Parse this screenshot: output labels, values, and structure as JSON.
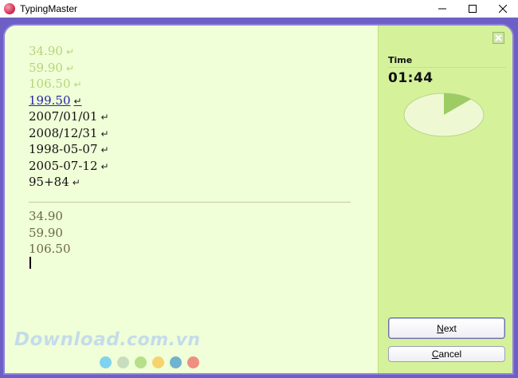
{
  "window": {
    "title": "TypingMaster"
  },
  "exercise": {
    "lines": [
      {
        "text": "34.90",
        "state": "done"
      },
      {
        "text": "59.90",
        "state": "done"
      },
      {
        "text": "106.50",
        "state": "done"
      },
      {
        "text": "199.50",
        "state": "current"
      },
      {
        "text": "2007/01/01",
        "state": "pending"
      },
      {
        "text": "2008/12/31",
        "state": "pending"
      },
      {
        "text": "1998-05-07",
        "state": "pending"
      },
      {
        "text": "2005-07-12",
        "state": "pending"
      },
      {
        "text": "95+84",
        "state": "pending"
      }
    ],
    "return_symbol": "↵",
    "typed": [
      "34.90",
      "59.90",
      "106.50"
    ]
  },
  "timer": {
    "label": "Time",
    "value": "01:44",
    "elapsed_fraction": 0.12
  },
  "buttons": {
    "next_accel": "N",
    "next_rest": "ext",
    "cancel_accel": "C",
    "cancel_rest": "ancel"
  },
  "watermark": {
    "text_main": "Download",
    "text_domain": ".com.vn",
    "dot_colors": [
      "#7fd3ef",
      "#c8ddc0",
      "#b7df8a",
      "#f7d36e",
      "#6fb3cf",
      "#ef8f7f"
    ]
  },
  "colors": {
    "frame": "#6d5fc6",
    "text_area_bg": "#f0ffd8",
    "side_panel_bg": "#d5f29b",
    "done_text": "#b7d47a",
    "current_text": "#2525a8"
  }
}
